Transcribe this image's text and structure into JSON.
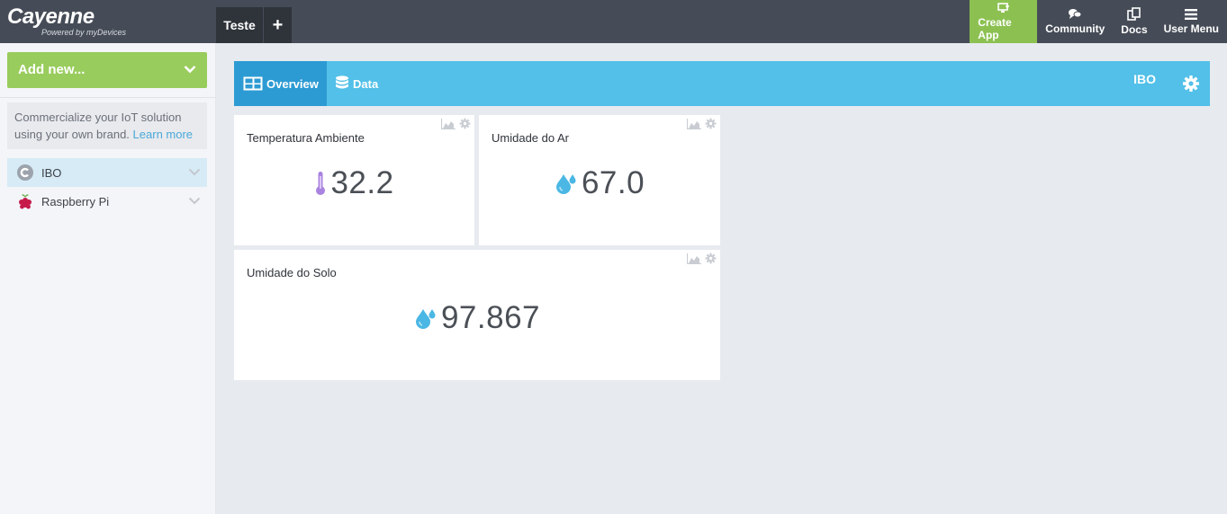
{
  "brand": {
    "name": "Cayenne",
    "tagline": "Powered by myDevices"
  },
  "project_tab": {
    "label": "Teste",
    "add_label": "+"
  },
  "topnav": [
    {
      "label": "Create App",
      "icon": "create-app-icon"
    },
    {
      "label": "Community",
      "icon": "community-icon"
    },
    {
      "label": "Docs",
      "icon": "docs-icon"
    },
    {
      "label": "User Menu",
      "icon": "hamburger-icon"
    }
  ],
  "sidebar": {
    "add_new_label": "Add new...",
    "promo_text": "Commercialize your IoT solution using your own brand.",
    "promo_link": "Learn more",
    "devices": [
      {
        "label": "IBO",
        "icon": "cayenne-device-icon",
        "selected": true
      },
      {
        "label": "Raspberry Pi",
        "icon": "raspberry-pi-icon",
        "selected": false
      }
    ]
  },
  "main": {
    "tabs": [
      {
        "label": "Overview",
        "icon": "overview-icon",
        "active": true
      },
      {
        "label": "Data",
        "icon": "database-icon",
        "active": false
      }
    ],
    "device_title": "IBO"
  },
  "widgets": [
    {
      "title": "Temperatura Ambiente",
      "value": "32.2",
      "icon": "thermometer-icon"
    },
    {
      "title": "Umidade do Ar",
      "value": "67.0",
      "icon": "water-drops-icon"
    },
    {
      "title": "Umidade do Solo",
      "value": "97.867",
      "icon": "water-drops-icon"
    }
  ],
  "colors": {
    "topbar": "#464c57",
    "accent_green": "#8cc152",
    "header_blue": "#52c0e8",
    "active_tab_blue": "#2d9bd3",
    "thermometer": "#a983e0",
    "drop": "#4ab7e4"
  }
}
